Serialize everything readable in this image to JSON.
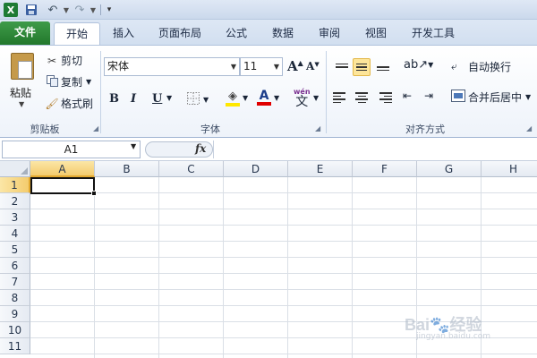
{
  "quick_access": {
    "app_icon": "X"
  },
  "tabs": {
    "file": "文件",
    "home": "开始",
    "insert": "插入",
    "layout": "页面布局",
    "formula": "公式",
    "data": "数据",
    "review": "审阅",
    "view": "视图",
    "developer": "开发工具"
  },
  "clipboard": {
    "paste": "粘贴",
    "cut": "剪切",
    "copy": "复制",
    "format_painter": "格式刷",
    "group_label": "剪贴板"
  },
  "font": {
    "name": "宋体",
    "size": "11",
    "group_label": "字体",
    "bold": "B",
    "italic": "I",
    "underline": "U",
    "grow": "A",
    "shrink": "A",
    "color_letter": "A",
    "phonetic_top": "wén",
    "phonetic": "文"
  },
  "alignment": {
    "wrap_text": "自动换行",
    "merge_center": "合并后居中",
    "group_label": "对齐方式"
  },
  "formula_bar": {
    "name_box": "A1",
    "fx": "fx",
    "formula": ""
  },
  "grid": {
    "columns": [
      "A",
      "B",
      "C",
      "D",
      "E",
      "F",
      "G",
      "H"
    ],
    "rows": [
      "1",
      "2",
      "3",
      "4",
      "5",
      "6",
      "7",
      "8",
      "9",
      "10",
      "11"
    ],
    "active_cell": "A1"
  },
  "colors": {
    "accent_file_tab": "#2e8b3a",
    "active_header": "#f4cc6e",
    "highlight_yellow": "#ffe800",
    "font_red": "#e00000"
  },
  "watermark": "Bai 经验 jingyan.baidu.com"
}
